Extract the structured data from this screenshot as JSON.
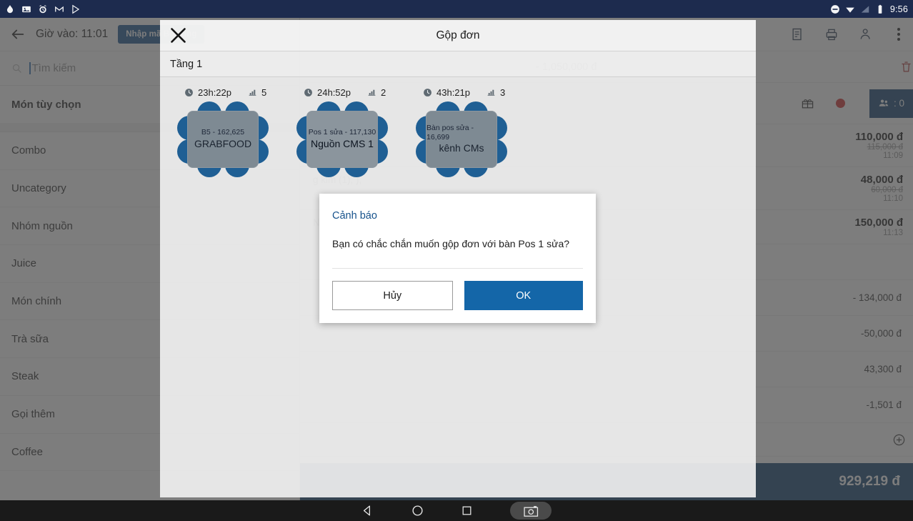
{
  "statusbar": {
    "time": "9:56",
    "left_icons": [
      "droplet-icon",
      "photo-icon",
      "alarm-icon",
      "gmail-icon",
      "play-icon"
    ],
    "right_icons": [
      "do-not-disturb-icon",
      "wifi-icon",
      "signal-icon",
      "battery-icon"
    ]
  },
  "appbar": {
    "back_icon": "back-arrow-icon",
    "title": "Giờ vào: 11:01",
    "booking_button": "Nhập mã Booking"
  },
  "search": {
    "icon": "search-icon",
    "placeholder": "Tìm kiếm",
    "value": ""
  },
  "categories": [
    {
      "label": "Món tùy chọn",
      "bold": true
    },
    {
      "label": "Combo",
      "bold": false
    },
    {
      "label": "Uncategory",
      "bold": false
    },
    {
      "label": "Nhóm nguồn",
      "bold": false
    },
    {
      "label": "Juice",
      "bold": false
    },
    {
      "label": "Món chính",
      "bold": false
    },
    {
      "label": "Trà sữa",
      "bold": false
    },
    {
      "label": "Steak",
      "bold": false
    },
    {
      "label": "Gọi thêm",
      "bold": false
    },
    {
      "label": "Coffee",
      "bold": false
    }
  ],
  "order_panel": {
    "toolbar_icons": [
      "note-icon",
      "print-icon",
      "customer-icon",
      "more-vertical-icon"
    ],
    "discount_row_value": "- 1,050,000 đ",
    "delete_icon": "trash-icon",
    "gift_icon": "gift-icon",
    "status_dot": "red-dot-icon",
    "guest_badge": ": 0",
    "guest_icon": "people-icon",
    "items": [
      {
        "name": "",
        "price": "110,000 đ",
        "old_price": "115,000 đ",
        "time": "11:09"
      },
      {
        "name": "g kim (1), ),",
        "price": "48,000 đ",
        "old_price": "60,000 đ",
        "time": "11:10"
      },
      {
        "name": "N)",
        "price": "150,000 đ",
        "old_price": "",
        "time": "11:13"
      }
    ],
    "summary": [
      {
        "label": "",
        "value": ""
      },
      {
        "label": "",
        "value": "- 134,000 đ"
      },
      {
        "label": "",
        "value": "-50,000 đ"
      },
      {
        "label": "",
        "value": "43,300 đ"
      },
      {
        "label": "",
        "value": "-1,501 đ"
      }
    ],
    "add_icon": "plus-circle-icon",
    "total_label": "",
    "total_value": "929,219 đ"
  },
  "merge_sheet": {
    "close_icon": "close-icon",
    "title": "Gộp đơn",
    "floor_label": "Tầng 1",
    "tables": [
      {
        "time": "23h:22p",
        "time_icon": "clock-icon",
        "seats": "5",
        "seats_icon": "chart-icon",
        "code_amount": "B5 - 162,625",
        "name": "GRABFOOD",
        "selected": false
      },
      {
        "time": "24h:52p",
        "time_icon": "clock-icon",
        "seats": "2",
        "seats_icon": "chart-icon",
        "code_amount": "Pos 1 sửa - 117,130",
        "name": "Nguồn CMS 1",
        "selected": true
      },
      {
        "time": "43h:21p",
        "time_icon": "clock-icon",
        "seats": "3",
        "seats_icon": "chart-icon",
        "code_amount": "Bàn pos sửa - 16,699",
        "name": "kênh CMs",
        "selected": false
      }
    ]
  },
  "alert": {
    "title": "Cảnh báo",
    "message": "Bạn có chắc chắn muốn gộp đơn với bàn  Pos 1 sửa?",
    "cancel_label": "Hủy",
    "ok_label": "OK",
    "ok_color": "#1466a8"
  },
  "navbar": {
    "back_icon": "nav-back-icon",
    "home_icon": "nav-home-icon",
    "recents_icon": "nav-recents-icon",
    "screenshot_icon": "nav-screenshot-icon"
  }
}
